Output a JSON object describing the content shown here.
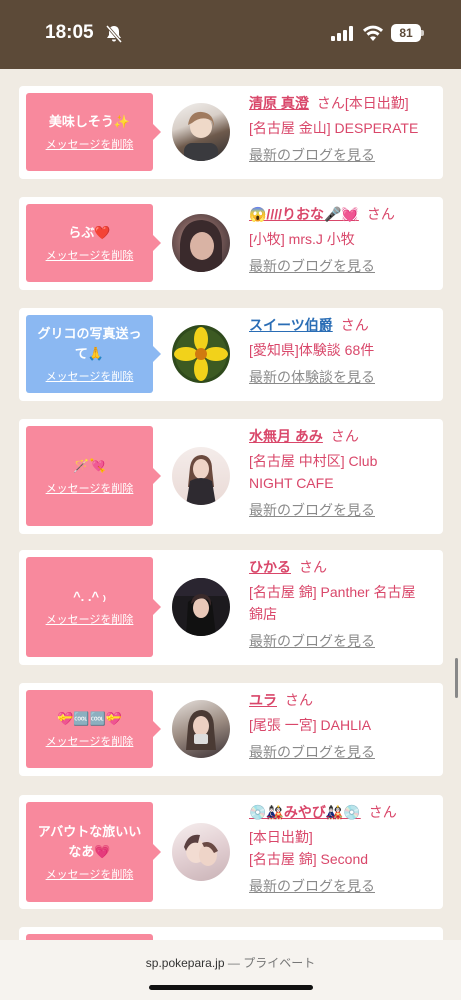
{
  "status_bar": {
    "time": "18:05",
    "battery": "81"
  },
  "conversations": [
    {
      "bubble_text": "美味しそう✨",
      "bubble_color": "pink",
      "delete_label": "メッセージを削除",
      "name": "清原 真澄",
      "honorific": "さん",
      "name_suffix": "[本日出勤]",
      "details": [
        "[名古屋 金山] DESPERATE"
      ],
      "link": "最新のブログを見る"
    },
    {
      "bubble_text": "らぶ❤️",
      "bubble_color": "pink",
      "delete_label": "メッセージを削除",
      "name": "😱////りおな🎤💓",
      "honorific": "さん",
      "name_suffix": "",
      "details": [
        "[小牧] mrs.J 小牧"
      ],
      "link": "最新のブログを見る"
    },
    {
      "bubble_text": "グリコの写真送って🙏",
      "bubble_color": "blue",
      "delete_label": "メッセージを削除",
      "name": "スイーツ伯爵",
      "honorific": "さん",
      "name_suffix": "",
      "details": [
        "[愛知県]体験談 68件"
      ],
      "link": "最新の体験談を見る"
    },
    {
      "bubble_text": "🪄💘",
      "bubble_color": "pink",
      "delete_label": "メッセージを削除",
      "name": "水無月 あみ",
      "honorific": "さん",
      "name_suffix": "",
      "details": [
        "[名古屋 中村区] Club",
        "NIGHT CAFE"
      ],
      "link": "最新のブログを見る"
    },
    {
      "bubble_text": "^. .^ ₎",
      "bubble_color": "pink",
      "delete_label": "メッセージを削除",
      "name": "ひかる",
      "honorific": "さん",
      "name_suffix": "",
      "details": [
        "[名古屋 錦] Panther 名古屋",
        "錦店"
      ],
      "link": "最新のブログを見る"
    },
    {
      "bubble_text": "💝🆒🆒💝",
      "bubble_color": "pink",
      "delete_label": "メッセージを削除",
      "name": "ユラ",
      "honorific": "さん",
      "name_suffix": "",
      "details": [
        "[尾張 一宮] DAHLIA"
      ],
      "link": "最新のブログを見る"
    },
    {
      "bubble_text": "アバウトな旅いいなあ💗",
      "bubble_color": "pink",
      "delete_label": "メッセージを削除",
      "name": "💿🎎みやび🎎💿",
      "honorific": "さん",
      "name_suffix": "",
      "details": [
        "[本日出勤]",
        "[名古屋 錦] Second"
      ],
      "link": "最新のブログを見る"
    }
  ],
  "browser_bar": {
    "domain": "sp.pokepara.jp",
    "mode": "— プライベート"
  },
  "colors": {
    "status_bar_bg": "#5c4a38",
    "page_bg": "#f0ebe3",
    "bubble_pink": "#f8899d",
    "bubble_blue": "#8bb8f2",
    "name_pink": "#d9476a",
    "name_blue": "#2a6db5"
  },
  "icons": {
    "bell": "bell-off-icon",
    "signal": "cellular-signal-icon",
    "wifi": "wifi-icon",
    "battery": "battery-icon"
  }
}
